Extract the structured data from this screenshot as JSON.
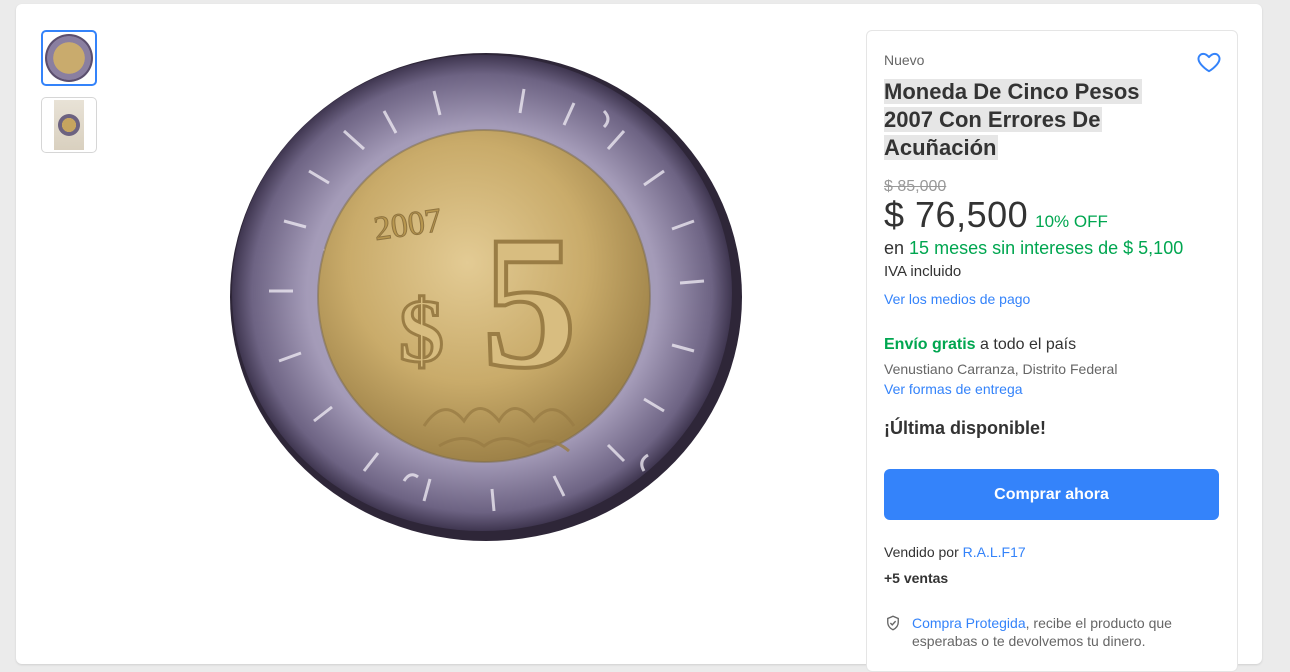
{
  "gallery": {
    "thumbnails": [
      "coin-front-thumbnail",
      "coin-photo-thumbnail"
    ],
    "coin_text": {
      "year": "2007",
      "denomination": "5",
      "currency_symbol": "$"
    }
  },
  "product": {
    "condition": "Nuevo",
    "title": "Moneda De Cinco Pesos 2007 Con Errores De Acuñación",
    "original_price": "$ 85,000",
    "price": "$ 76,500",
    "discount": "10% OFF",
    "installments_prefix": "en",
    "installments": "15 meses sin intereses de $ 5,100",
    "tax_note": "IVA incluido",
    "payment_link": "Ver los medios de pago"
  },
  "shipping": {
    "free_label": "Envío gratis",
    "scope": "a todo el país",
    "location": "Venustiano Carranza, Distrito Federal",
    "delivery_link": "Ver formas de entrega"
  },
  "stock": {
    "label": "¡Última disponible!"
  },
  "actions": {
    "buy_now": "Comprar ahora"
  },
  "seller": {
    "label": "Vendido por",
    "name": "R.A.L.F17",
    "sales": "+5 ventas"
  },
  "protection": {
    "link": "Compra Protegida",
    "text": ", recibe el producto que esperabas o te devolvemos tu dinero."
  },
  "icons": {
    "favorite": "heart-outline-icon",
    "protection": "shield-check-icon"
  },
  "colors": {
    "accent": "#3483fa",
    "green": "#00a650",
    "background": "#ebebeb"
  }
}
